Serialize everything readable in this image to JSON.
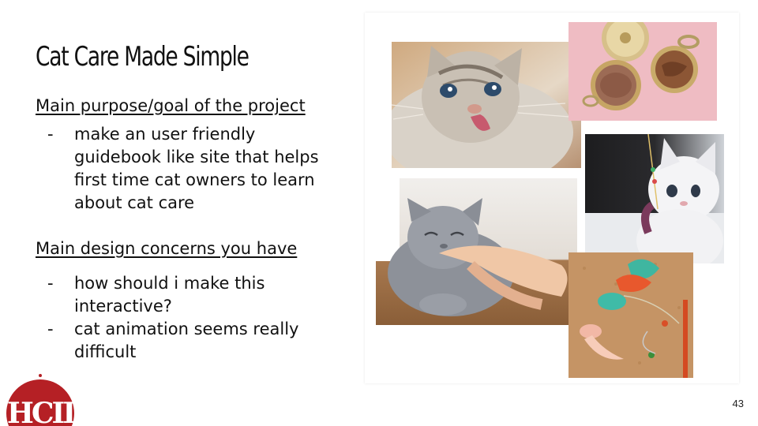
{
  "slide": {
    "title": "Cat Care Made Simple",
    "page_number": "43"
  },
  "sections": [
    {
      "heading": "Main purpose/goal of the project",
      "bullets": [
        "make an user friendly guidebook like site that helps first time cat owners to learn about cat care"
      ]
    },
    {
      "heading": "Main design concerns you have",
      "bullets": [
        "how should i make this interactive?",
        "cat animation seems really difficult"
      ]
    }
  ],
  "bullet_marker": "-",
  "logo": {
    "text": "HCII",
    "color": "#b52025"
  },
  "collage": {
    "photos": [
      {
        "name": "tabby-cat-licking-photo",
        "icon": "tabby-cat-icon"
      },
      {
        "name": "canned-cat-food-photo",
        "icon": "cat-food-can-icon"
      },
      {
        "name": "white-kitten-with-toy-photo",
        "icon": "white-kitten-icon"
      },
      {
        "name": "gray-cat-petted-photo",
        "icon": "gray-cat-icon"
      },
      {
        "name": "feather-cat-toys-photo",
        "icon": "feather-toy-icon"
      }
    ],
    "colors": {
      "pink_background": "#efbcc3",
      "cork_board": "#c59465",
      "gray_cat": "#8d9199",
      "tabby_fur": "#c9c0b4"
    }
  }
}
